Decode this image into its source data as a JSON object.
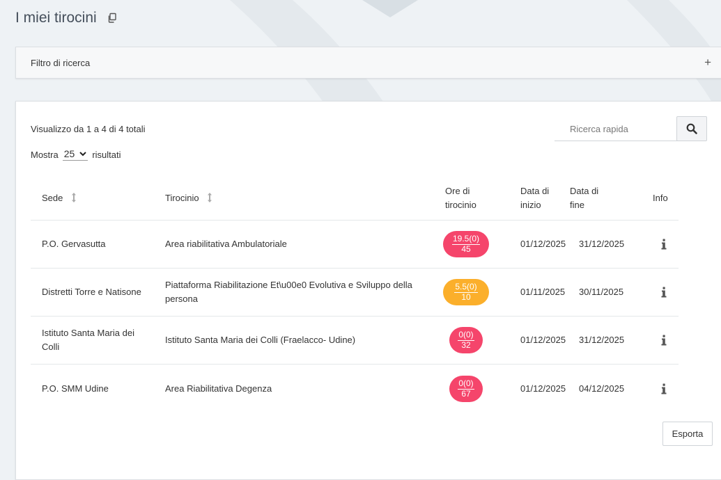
{
  "page": {
    "title": "I miei tirocini",
    "copy_icon": "copy-icon"
  },
  "filter": {
    "label": "Filtro di ricerca",
    "toggle": "+"
  },
  "listing": {
    "showing": "Visualizzo da 1 a 4 di 4 totali",
    "show_prefix": "Mostra",
    "per_page": "25",
    "show_suffix": "risultati",
    "search_placeholder": "Ricerca rapida",
    "search_icon": "search-icon",
    "export_label": "Esporta"
  },
  "table": {
    "headers": {
      "sede": "Sede",
      "tirocinio": "Tirocinio",
      "ore_line1": "Ore di",
      "ore_line2": "tirocinio",
      "inizio_line1": "Data di",
      "inizio_line2": "inizio",
      "fine_line1": "Data di",
      "fine_line2": "fine",
      "info": "Info"
    },
    "rows": [
      {
        "sede": "P.O. Gervasutta",
        "tirocinio": "Area riabilitativa Ambulatoriale",
        "ore_done": "19.5(0)",
        "ore_total": "45",
        "ore_color": "#f5456b",
        "inizio": "01/12/2025",
        "fine": "31/12/2025"
      },
      {
        "sede": "Distretti Torre e Natisone",
        "tirocinio": "Piattaforma Riabilitazione Et\\u00e0 Evolutiva e Sviluppo della persona",
        "ore_done": "5.5(0)",
        "ore_total": "10",
        "ore_color": "#fbaf2b",
        "inizio": "01/11/2025",
        "fine": "30/11/2025"
      },
      {
        "sede": "Istituto Santa Maria dei Colli",
        "tirocinio": "Istituto Santa Maria dei Colli (Fraelacco- Udine)",
        "ore_done": "0(0)",
        "ore_total": "32",
        "ore_color": "#f5456b",
        "inizio": "01/12/2025",
        "fine": "31/12/2025"
      },
      {
        "sede": "P.O. SMM Udine",
        "tirocinio": "Area Riabilitativa Degenza",
        "ore_done": "0(0)",
        "ore_total": "67",
        "ore_color": "#f5456b",
        "inizio": "01/12/2025",
        "fine": "04/12/2025"
      }
    ]
  }
}
